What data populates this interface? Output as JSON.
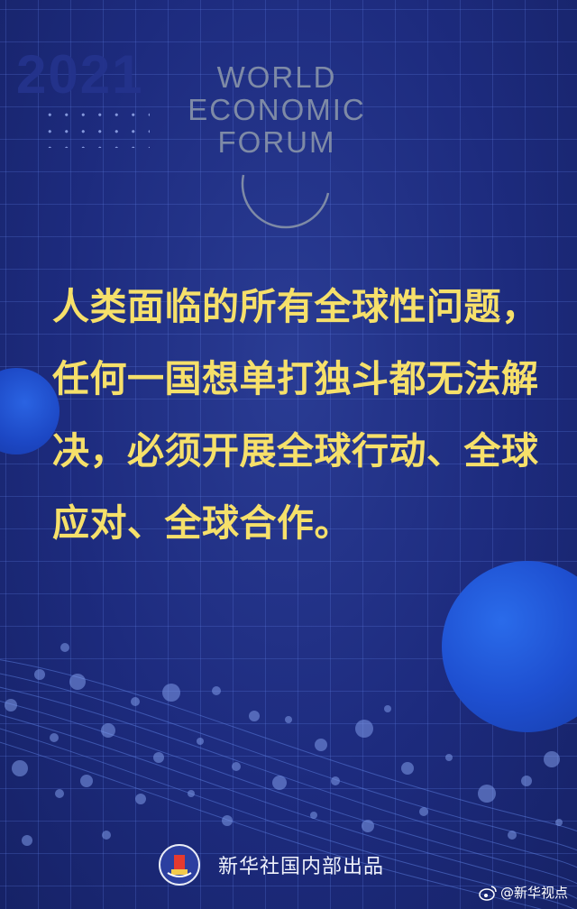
{
  "poster": {
    "year": "2021",
    "logo": {
      "line1": "WORLD",
      "line2": "ECONOMIC",
      "line3": "FORUM"
    },
    "quote_lines": [
      "人类面临的所有全球性问题，",
      "任何一国想单打独斗都无法解",
      "决，必须开展全球行动、全球",
      "应对、全球合作。"
    ],
    "footer_text": "新华社国内部出品",
    "watermark_text": "@新华视点"
  },
  "colors": {
    "background": "#1c2a78",
    "quote_text": "#f6e06a",
    "logo_text": "#7e8aa6",
    "accent_sphere": "#1e4fd0"
  },
  "icons": {
    "footer_logo": "xinhua-emblem-icon",
    "watermark_logo": "weibo-icon"
  }
}
